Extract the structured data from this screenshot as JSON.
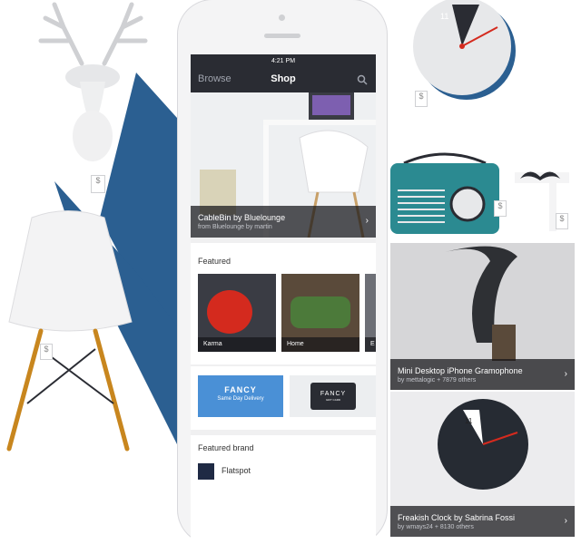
{
  "colors": {
    "navy": "#2b5f91",
    "teal": "#2b8a91",
    "blue_banner": "#4a90d6",
    "dark_bar": "#2a2c33"
  },
  "phone": {
    "status_time": "4:21 PM",
    "nav": {
      "left": "Browse",
      "title": "Shop",
      "search_icon": "search-icon"
    },
    "hero": {
      "title": "CableBin by Bluelounge",
      "subtitle": "from Bluelounge by martin"
    },
    "featured": {
      "heading": "Featured",
      "items": [
        {
          "label": "Karma"
        },
        {
          "label": "Home"
        },
        {
          "label": "E"
        }
      ]
    },
    "banners": {
      "left": {
        "title": "FANCY",
        "subtitle": "Same Day Delivery"
      },
      "right": {
        "title": "FANCY",
        "subtitle": "GIFT CARD"
      }
    },
    "brand": {
      "heading": "Featured brand",
      "name": "Flatspot"
    }
  },
  "cards": {
    "gramophone": {
      "title": "Mini Desktop iPhone Gramophone",
      "subtitle": "by mettalogic + 7879 others"
    },
    "clock": {
      "title": "Freakish Clock by Sabrina Fossi",
      "subtitle": "by wmays24 + 8130 others",
      "number": "11"
    }
  },
  "tags": {
    "price_symbol": "$"
  },
  "top_clock_number": "11"
}
